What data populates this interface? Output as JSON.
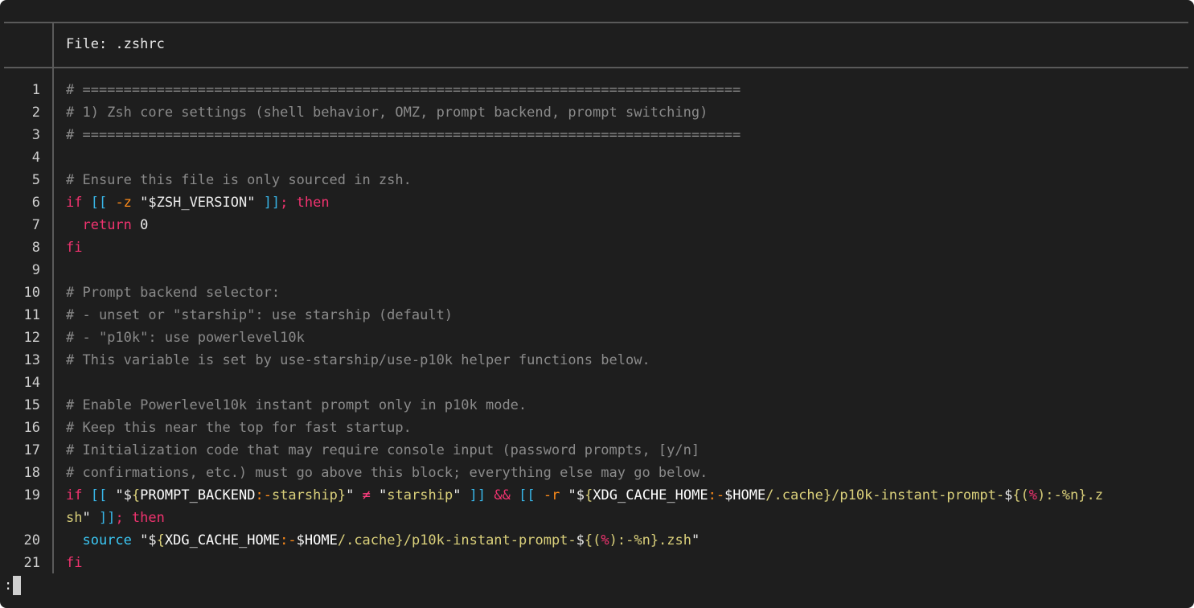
{
  "header": {
    "file_label": "File: .zshrc"
  },
  "lines": [
    {
      "n": "1",
      "parts": [
        {
          "c": "cm",
          "t": "# ================================================================================"
        }
      ]
    },
    {
      "n": "2",
      "parts": [
        {
          "c": "cm",
          "t": "# 1) Zsh core settings (shell behavior, OMZ, prompt backend, prompt switching)"
        }
      ]
    },
    {
      "n": "3",
      "parts": [
        {
          "c": "cm",
          "t": "# ================================================================================"
        }
      ]
    },
    {
      "n": "4",
      "parts": [
        {
          "c": "df",
          "t": ""
        }
      ]
    },
    {
      "n": "5",
      "parts": [
        {
          "c": "cm",
          "t": "# Ensure this file is only sourced in zsh."
        }
      ]
    },
    {
      "n": "6",
      "parts": [
        {
          "c": "kw",
          "t": "if "
        },
        {
          "c": "br",
          "t": "[[ "
        },
        {
          "c": "op",
          "t": "-z "
        },
        {
          "c": "df",
          "t": "\"$ZSH_VERSION\" "
        },
        {
          "c": "br",
          "t": "]]"
        },
        {
          "c": "kw",
          "t": "; then"
        }
      ]
    },
    {
      "n": "7",
      "parts": [
        {
          "c": "df",
          "t": "  "
        },
        {
          "c": "kw",
          "t": "return "
        },
        {
          "c": "df",
          "t": "0"
        }
      ]
    },
    {
      "n": "8",
      "parts": [
        {
          "c": "kw",
          "t": "fi"
        }
      ]
    },
    {
      "n": "9",
      "parts": [
        {
          "c": "df",
          "t": ""
        }
      ]
    },
    {
      "n": "10",
      "parts": [
        {
          "c": "cm",
          "t": "# Prompt backend selector:"
        }
      ]
    },
    {
      "n": "11",
      "parts": [
        {
          "c": "cm",
          "t": "# - unset or \"starship\": use starship (default)"
        }
      ]
    },
    {
      "n": "12",
      "parts": [
        {
          "c": "cm",
          "t": "# - \"p10k\": use powerlevel10k"
        }
      ]
    },
    {
      "n": "13",
      "parts": [
        {
          "c": "cm",
          "t": "# This variable is set by use-starship/use-p10k helper functions below."
        }
      ]
    },
    {
      "n": "14",
      "parts": [
        {
          "c": "df",
          "t": ""
        }
      ]
    },
    {
      "n": "15",
      "parts": [
        {
          "c": "cm",
          "t": "# Enable Powerlevel10k instant prompt only in p10k mode."
        }
      ]
    },
    {
      "n": "16",
      "parts": [
        {
          "c": "cm",
          "t": "# Keep this near the top for fast startup."
        }
      ]
    },
    {
      "n": "17",
      "parts": [
        {
          "c": "cm",
          "t": "# Initialization code that may require console input (password prompts, [y/n]"
        }
      ]
    },
    {
      "n": "18",
      "parts": [
        {
          "c": "cm",
          "t": "# confirmations, etc.) must go above this block; everything else may go below."
        }
      ]
    },
    {
      "n": "19",
      "parts": [
        {
          "c": "kw",
          "t": "if "
        },
        {
          "c": "br",
          "t": "[[ "
        },
        {
          "c": "df",
          "t": "\"$"
        },
        {
          "c": "st",
          "t": "{"
        },
        {
          "c": "vr",
          "t": "PROMPT_BACKEND"
        },
        {
          "c": "op",
          "t": ":-"
        },
        {
          "c": "st",
          "t": "starship}"
        },
        {
          "c": "df",
          "t": "\" "
        },
        {
          "c": "nf",
          "t": "≠"
        },
        {
          "c": "df",
          "t": " \""
        },
        {
          "c": "st",
          "t": "starship"
        },
        {
          "c": "df",
          "t": "\" "
        },
        {
          "c": "br",
          "t": "]] "
        },
        {
          "c": "kw",
          "t": "&& "
        },
        {
          "c": "br",
          "t": "[[ "
        },
        {
          "c": "op",
          "t": "-r "
        },
        {
          "c": "df",
          "t": "\"$"
        },
        {
          "c": "st",
          "t": "{"
        },
        {
          "c": "vr",
          "t": "XDG_CACHE_HOME"
        },
        {
          "c": "op",
          "t": ":-"
        },
        {
          "c": "vr",
          "t": "$HOME"
        },
        {
          "c": "st",
          "t": "/.cache}/p10k-instant-prompt-"
        },
        {
          "c": "df",
          "t": "$"
        },
        {
          "c": "st",
          "t": "{("
        },
        {
          "c": "kw",
          "t": "%"
        },
        {
          "c": "st",
          "t": "):-%n}.z"
        }
      ]
    },
    {
      "n": "",
      "parts": [
        {
          "c": "st",
          "t": "sh"
        },
        {
          "c": "df",
          "t": "\" "
        },
        {
          "c": "br",
          "t": "]]"
        },
        {
          "c": "kw",
          "t": "; then"
        }
      ]
    },
    {
      "n": "20",
      "parts": [
        {
          "c": "df",
          "t": "  "
        },
        {
          "c": "cmd",
          "t": "source "
        },
        {
          "c": "df",
          "t": "\"$"
        },
        {
          "c": "st",
          "t": "{"
        },
        {
          "c": "vr",
          "t": "XDG_CACHE_HOME"
        },
        {
          "c": "op",
          "t": ":-"
        },
        {
          "c": "vr",
          "t": "$HOME"
        },
        {
          "c": "st",
          "t": "/.cache}/p10k-instant-prompt-"
        },
        {
          "c": "df",
          "t": "$"
        },
        {
          "c": "st",
          "t": "{("
        },
        {
          "c": "kw",
          "t": "%"
        },
        {
          "c": "st",
          "t": "):-%n}.zsh"
        },
        {
          "c": "df",
          "t": "\""
        }
      ]
    },
    {
      "n": "21",
      "parts": [
        {
          "c": "kw",
          "t": "fi"
        }
      ]
    }
  ],
  "pager": {
    "prompt": ":"
  }
}
